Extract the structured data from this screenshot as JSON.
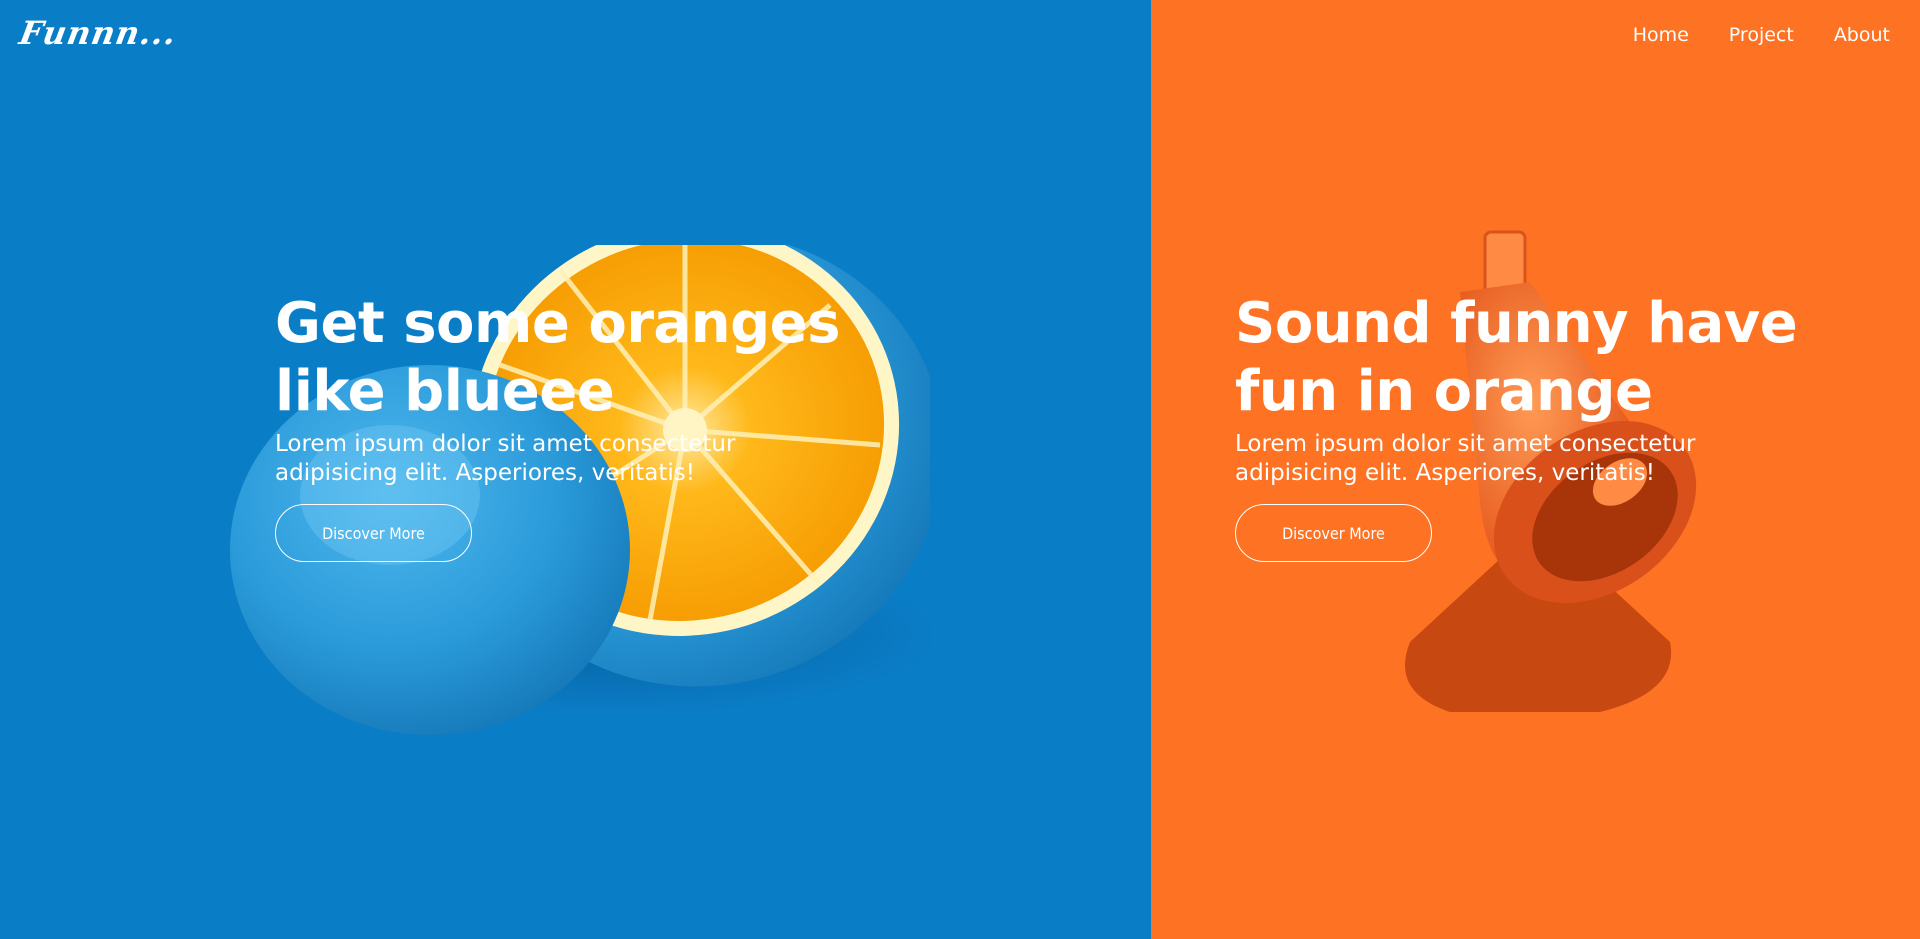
{
  "header": {
    "logo": "Funnn...",
    "nav": [
      {
        "label": "Home"
      },
      {
        "label": "Project"
      },
      {
        "label": "About"
      }
    ]
  },
  "panels": {
    "left": {
      "background": "#0a7dc7",
      "title_line1": "Get some oranges",
      "title_line2": "like blueee",
      "description": "Lorem ipsum dolor sit amet consectetur adipisicing elit. Asperiores, veritatis!",
      "button_label": "Discover More",
      "image": "blue-orange-halves"
    },
    "right": {
      "background": "#fe7224",
      "title_line1": "Sound funny have",
      "title_line2": "fun in orange",
      "description": "Lorem ipsum dolor sit amet consectetur adipisicing elit. Asperiores, veritatis!",
      "button_label": "Discover More",
      "image": "orange-megaphone"
    }
  }
}
